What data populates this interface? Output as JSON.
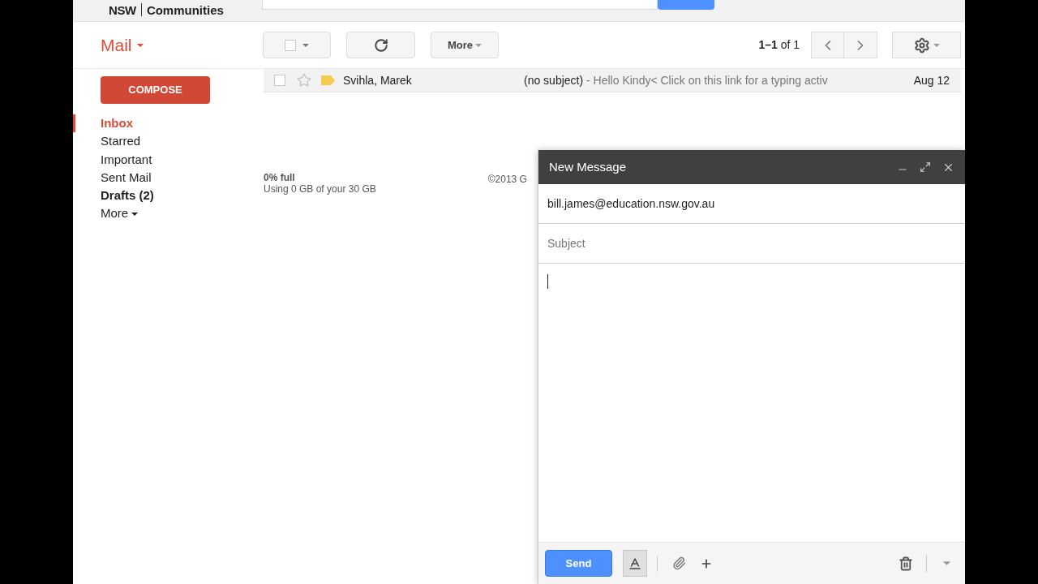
{
  "header": {
    "logo_mark": "NSW",
    "logo_text": "Communities"
  },
  "app_title": "Mail",
  "compose_button": "COMPOSE",
  "folders": [
    {
      "label": "Inbox",
      "selected": true,
      "bold": true
    },
    {
      "label": "Starred",
      "selected": false,
      "bold": false
    },
    {
      "label": "Important",
      "selected": false,
      "bold": false
    },
    {
      "label": "Sent Mail",
      "selected": false,
      "bold": false
    },
    {
      "label": "Drafts (2)",
      "selected": false,
      "bold": true
    }
  ],
  "more_folders": "More",
  "toolbar": {
    "more": "More",
    "pagination": "1–1 of 1"
  },
  "messages": [
    {
      "sender": "Svihla, Marek",
      "subject": "(no subject)",
      "snippet": " - Hello Kindy< Click on this link for a typing activ",
      "date": "Aug 12",
      "checked": false,
      "starred": false,
      "important": true
    }
  ],
  "storage": {
    "percent": "0% full",
    "usage": "Using 0 GB of your 30 GB"
  },
  "footer": {
    "copyright": "©2013 G"
  },
  "compose": {
    "title": "New Message",
    "to": "bill.james@education.nsw.gov.au",
    "subject_placeholder": "Subject",
    "send": "Send"
  }
}
